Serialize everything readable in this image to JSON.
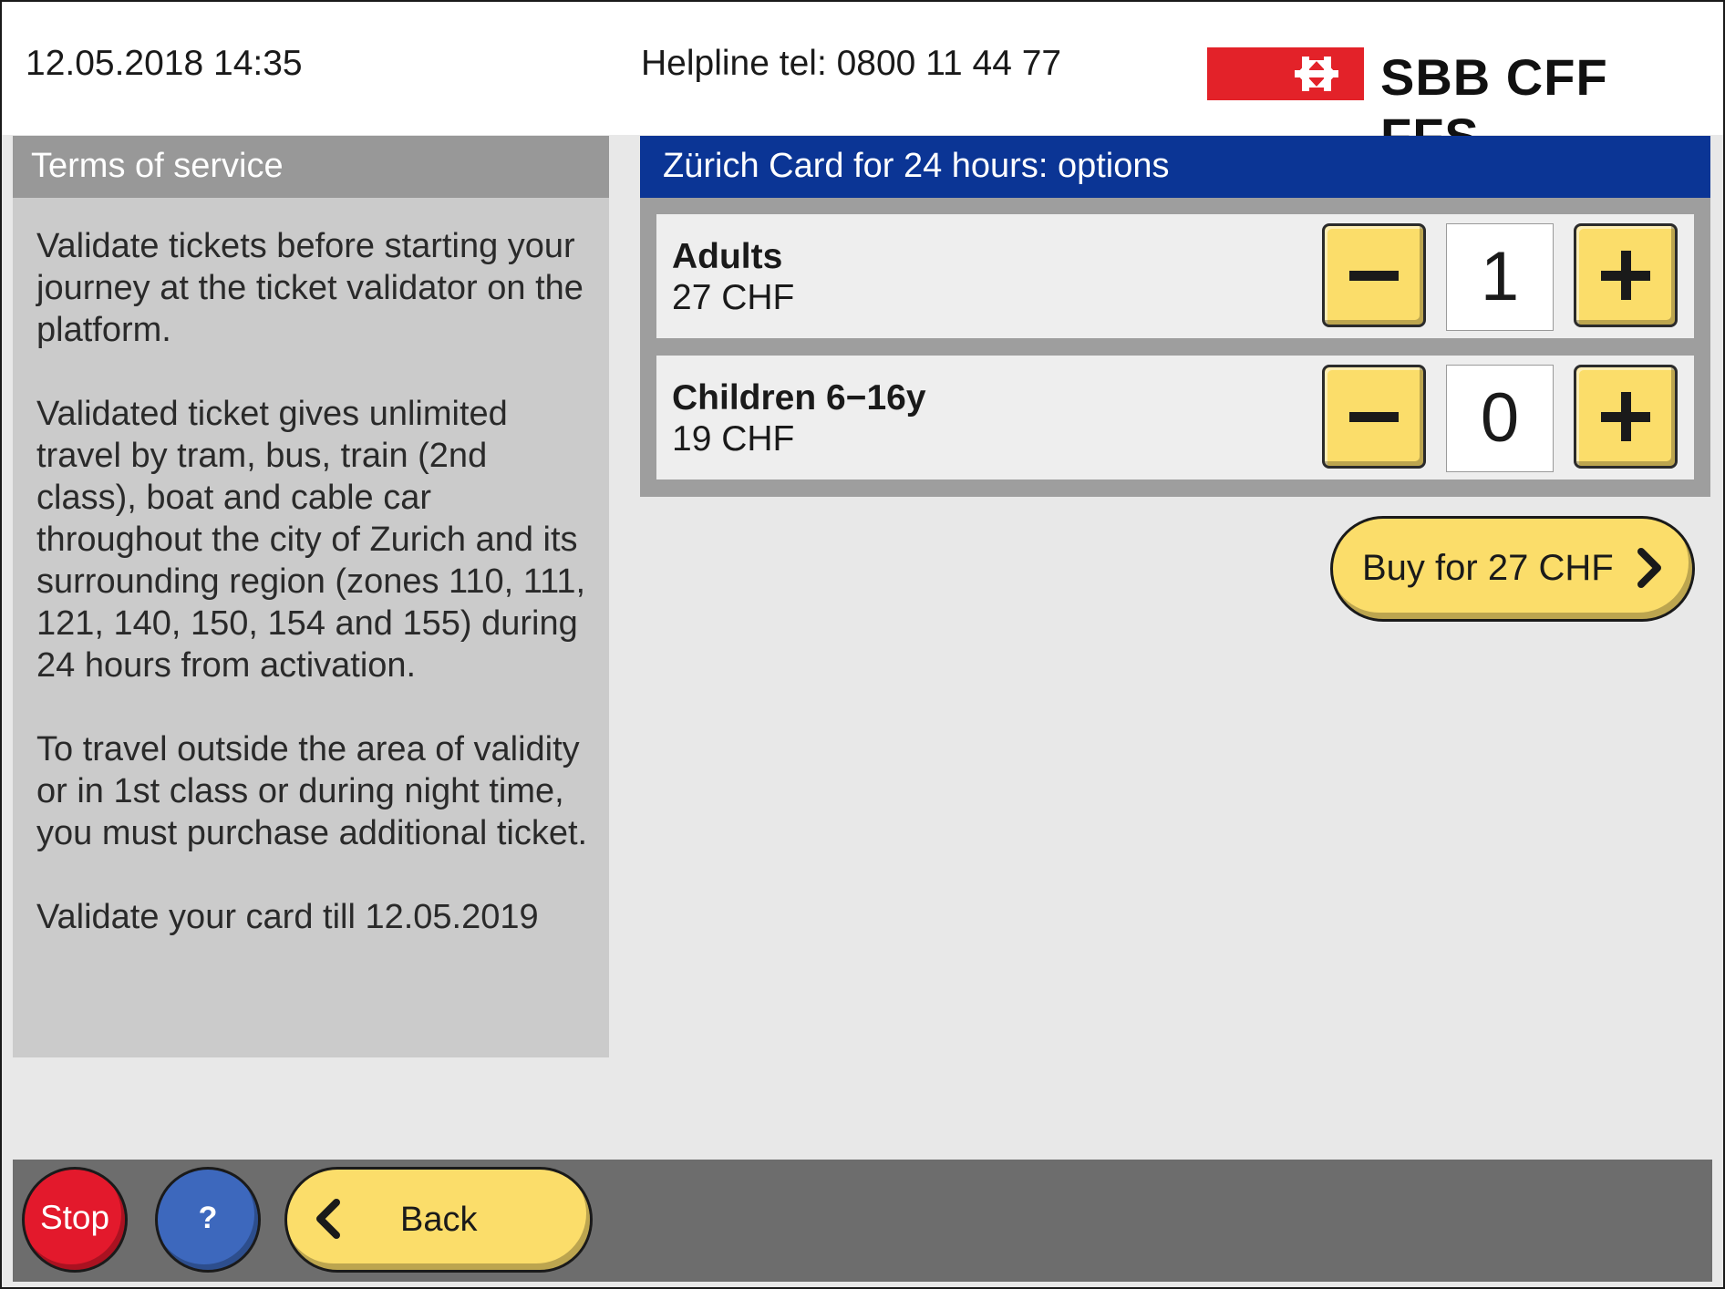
{
  "header": {
    "datetime": "12.05.2018 14:35",
    "helpline": "Helpline tel: 0800 11 44 77",
    "logo_text": "SBB CFF FFS"
  },
  "terms": {
    "title": "Terms of service",
    "paragraphs": [
      "Validate tickets before starting your journey at the ticket validator on the platform.",
      "Validated ticket gives unlimited travel by tram, bus, train (2nd class), boat and cable car throughout the city of Zurich and its surrounding region (zones 110, 111, 121, 140, 150, 154 and 155) during 24 hours from activation.",
      "To travel outside the area of validity or in 1st class or during night time, you must purchase additional ticket.",
      "Validate your card till 12.05.2019"
    ]
  },
  "options": {
    "title": "Zürich Card for 24 hours: options",
    "rows": [
      {
        "label": "Adults",
        "price": "27 CHF",
        "quantity": "1",
        "minus": "−",
        "plus": "+"
      },
      {
        "label": "Children 6−16y",
        "price": "19 CHF",
        "quantity": "0",
        "minus": "−",
        "plus": "+"
      }
    ],
    "buy_label": "Buy for 27 CHF",
    "buy_icon": "chevron-right-icon"
  },
  "footer": {
    "stop_label": "Stop",
    "help_label": "?",
    "back_label": "Back",
    "back_icon": "chevron-left-icon"
  },
  "colors": {
    "accent_blue": "#0b3595",
    "button_yellow": "#fbdd6a",
    "stop_red": "#e3192c",
    "help_blue": "#3d68bd",
    "sbb_red": "#e32229"
  }
}
